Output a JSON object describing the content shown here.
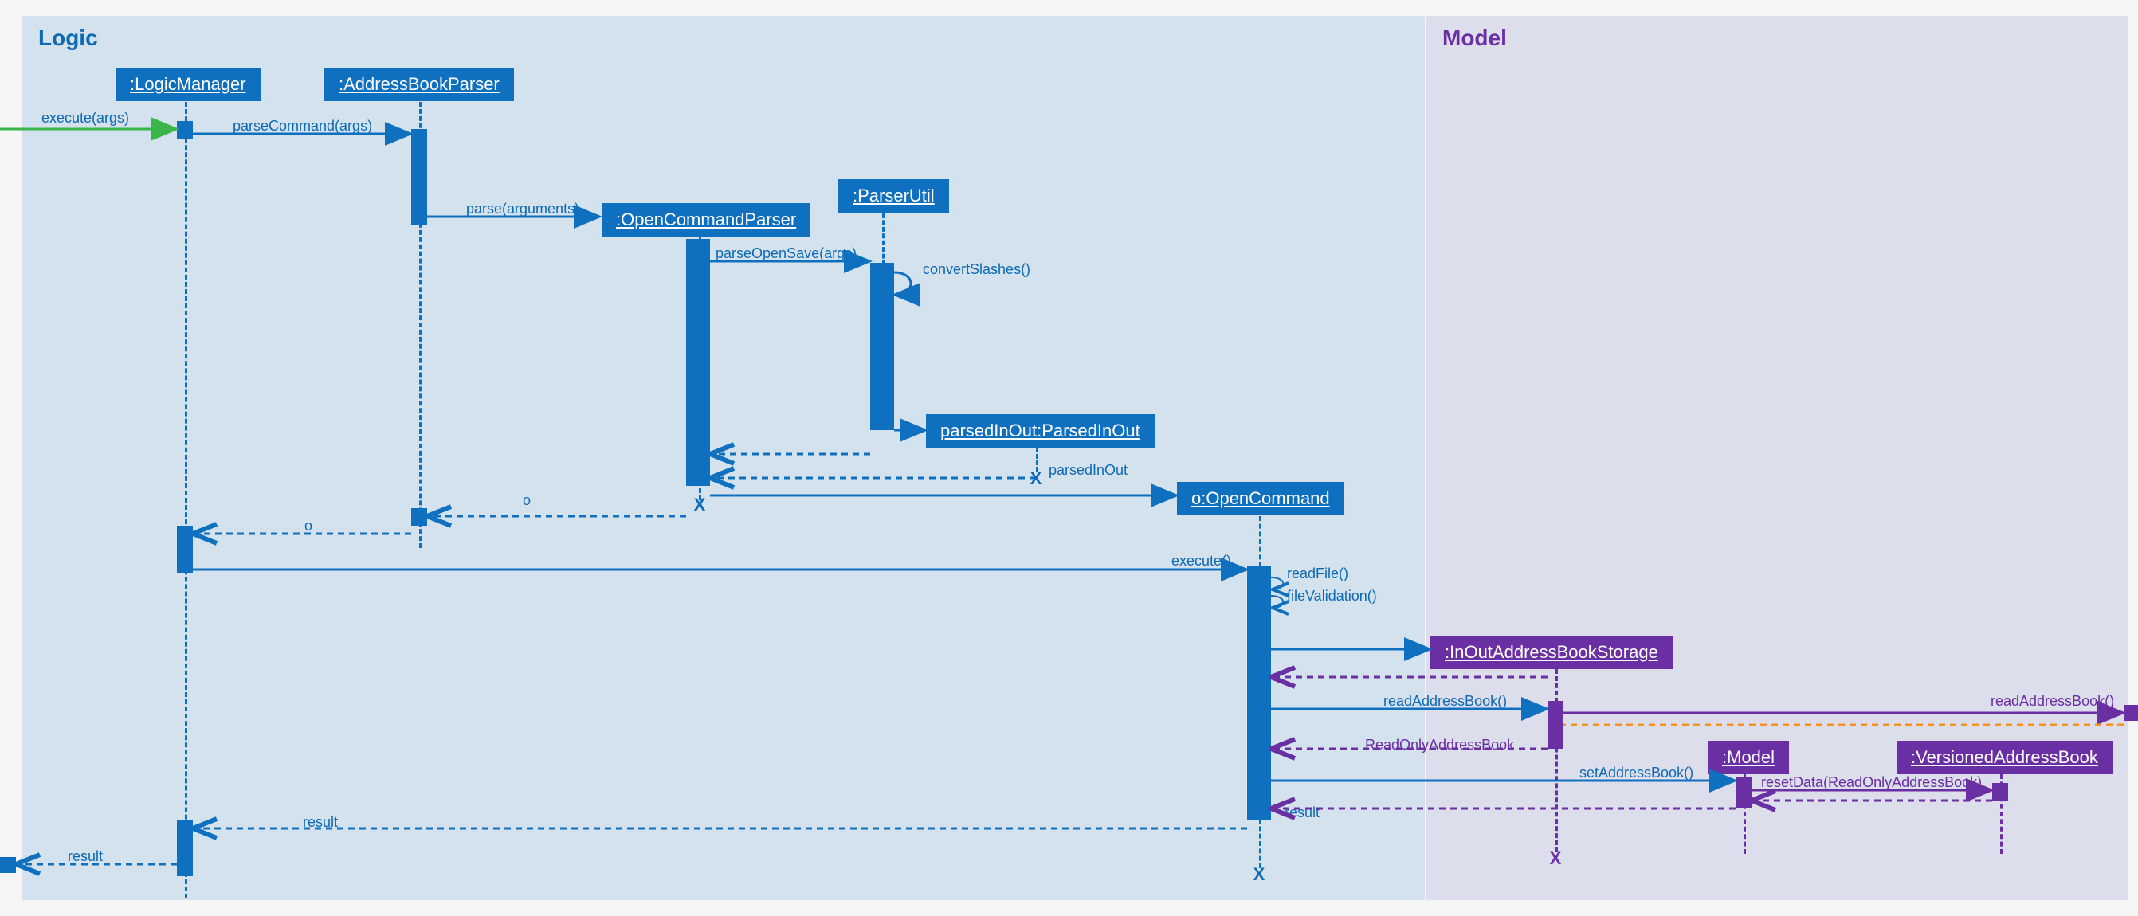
{
  "regions": {
    "logic": "Logic",
    "model": "Model"
  },
  "participants": {
    "logicManager": ":LogicManager",
    "addressBookParser": ":AddressBookParser",
    "openCommandParser": ":OpenCommandParser",
    "parserUtil": ":ParserUtil",
    "parsedInOut": "parsedInOut:ParsedInOut",
    "openCommand": "o:OpenCommand",
    "inOutStorage": ":InOutAddressBookStorage",
    "model": ":Model",
    "versionedAB": ":VersionedAddressBook"
  },
  "messages": {
    "execute_args": "execute(args)",
    "parseCommand": "parseCommand(args)",
    "parse": "parse(arguments)",
    "parseOpenSave": "parseOpenSave(args)",
    "convertSlashes": "convertSlashes()",
    "parsedInOut": "parsedInOut",
    "o": "o",
    "execute": "execute()",
    "readFile": "readFile()",
    "fileValidation": "fileValidation()",
    "readAddressBook": "readAddressBook()",
    "readAddressBook2": "readAddressBook()",
    "readOnlyAB": "ReadOnlyAddressBook",
    "setAddressBook": "setAddressBook()",
    "resetData": "resetData(ReadOnlyAddressBook)",
    "result": "result",
    "result2": "result"
  },
  "colors": {
    "logicBg": "#d4e2ee",
    "modelBg": "#dddeeb",
    "blue": "#1070c0",
    "purple": "#6b2fa4",
    "green": "#39b54a",
    "orange": "#f7931e"
  },
  "diagram_type": "UML Sequence Diagram"
}
